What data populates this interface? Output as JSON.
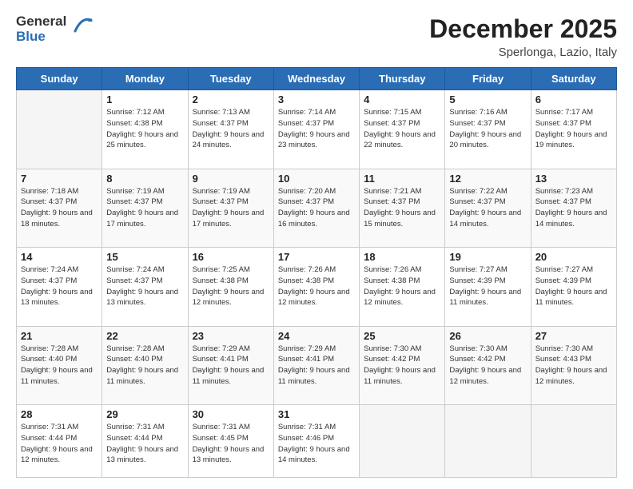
{
  "logo": {
    "general": "General",
    "blue": "Blue"
  },
  "header": {
    "month_year": "December 2025",
    "location": "Sperlonga, Lazio, Italy"
  },
  "weekdays": [
    "Sunday",
    "Monday",
    "Tuesday",
    "Wednesday",
    "Thursday",
    "Friday",
    "Saturday"
  ],
  "weeks": [
    [
      {
        "day": "",
        "sunrise": "",
        "sunset": "",
        "daylight": ""
      },
      {
        "day": "1",
        "sunrise": "Sunrise: 7:12 AM",
        "sunset": "Sunset: 4:38 PM",
        "daylight": "Daylight: 9 hours and 25 minutes."
      },
      {
        "day": "2",
        "sunrise": "Sunrise: 7:13 AM",
        "sunset": "Sunset: 4:37 PM",
        "daylight": "Daylight: 9 hours and 24 minutes."
      },
      {
        "day": "3",
        "sunrise": "Sunrise: 7:14 AM",
        "sunset": "Sunset: 4:37 PM",
        "daylight": "Daylight: 9 hours and 23 minutes."
      },
      {
        "day": "4",
        "sunrise": "Sunrise: 7:15 AM",
        "sunset": "Sunset: 4:37 PM",
        "daylight": "Daylight: 9 hours and 22 minutes."
      },
      {
        "day": "5",
        "sunrise": "Sunrise: 7:16 AM",
        "sunset": "Sunset: 4:37 PM",
        "daylight": "Daylight: 9 hours and 20 minutes."
      },
      {
        "day": "6",
        "sunrise": "Sunrise: 7:17 AM",
        "sunset": "Sunset: 4:37 PM",
        "daylight": "Daylight: 9 hours and 19 minutes."
      }
    ],
    [
      {
        "day": "7",
        "sunrise": "Sunrise: 7:18 AM",
        "sunset": "Sunset: 4:37 PM",
        "daylight": "Daylight: 9 hours and 18 minutes."
      },
      {
        "day": "8",
        "sunrise": "Sunrise: 7:19 AM",
        "sunset": "Sunset: 4:37 PM",
        "daylight": "Daylight: 9 hours and 17 minutes."
      },
      {
        "day": "9",
        "sunrise": "Sunrise: 7:19 AM",
        "sunset": "Sunset: 4:37 PM",
        "daylight": "Daylight: 9 hours and 17 minutes."
      },
      {
        "day": "10",
        "sunrise": "Sunrise: 7:20 AM",
        "sunset": "Sunset: 4:37 PM",
        "daylight": "Daylight: 9 hours and 16 minutes."
      },
      {
        "day": "11",
        "sunrise": "Sunrise: 7:21 AM",
        "sunset": "Sunset: 4:37 PM",
        "daylight": "Daylight: 9 hours and 15 minutes."
      },
      {
        "day": "12",
        "sunrise": "Sunrise: 7:22 AM",
        "sunset": "Sunset: 4:37 PM",
        "daylight": "Daylight: 9 hours and 14 minutes."
      },
      {
        "day": "13",
        "sunrise": "Sunrise: 7:23 AM",
        "sunset": "Sunset: 4:37 PM",
        "daylight": "Daylight: 9 hours and 14 minutes."
      }
    ],
    [
      {
        "day": "14",
        "sunrise": "Sunrise: 7:24 AM",
        "sunset": "Sunset: 4:37 PM",
        "daylight": "Daylight: 9 hours and 13 minutes."
      },
      {
        "day": "15",
        "sunrise": "Sunrise: 7:24 AM",
        "sunset": "Sunset: 4:37 PM",
        "daylight": "Daylight: 9 hours and 13 minutes."
      },
      {
        "day": "16",
        "sunrise": "Sunrise: 7:25 AM",
        "sunset": "Sunset: 4:38 PM",
        "daylight": "Daylight: 9 hours and 12 minutes."
      },
      {
        "day": "17",
        "sunrise": "Sunrise: 7:26 AM",
        "sunset": "Sunset: 4:38 PM",
        "daylight": "Daylight: 9 hours and 12 minutes."
      },
      {
        "day": "18",
        "sunrise": "Sunrise: 7:26 AM",
        "sunset": "Sunset: 4:38 PM",
        "daylight": "Daylight: 9 hours and 12 minutes."
      },
      {
        "day": "19",
        "sunrise": "Sunrise: 7:27 AM",
        "sunset": "Sunset: 4:39 PM",
        "daylight": "Daylight: 9 hours and 11 minutes."
      },
      {
        "day": "20",
        "sunrise": "Sunrise: 7:27 AM",
        "sunset": "Sunset: 4:39 PM",
        "daylight": "Daylight: 9 hours and 11 minutes."
      }
    ],
    [
      {
        "day": "21",
        "sunrise": "Sunrise: 7:28 AM",
        "sunset": "Sunset: 4:40 PM",
        "daylight": "Daylight: 9 hours and 11 minutes."
      },
      {
        "day": "22",
        "sunrise": "Sunrise: 7:28 AM",
        "sunset": "Sunset: 4:40 PM",
        "daylight": "Daylight: 9 hours and 11 minutes."
      },
      {
        "day": "23",
        "sunrise": "Sunrise: 7:29 AM",
        "sunset": "Sunset: 4:41 PM",
        "daylight": "Daylight: 9 hours and 11 minutes."
      },
      {
        "day": "24",
        "sunrise": "Sunrise: 7:29 AM",
        "sunset": "Sunset: 4:41 PM",
        "daylight": "Daylight: 9 hours and 11 minutes."
      },
      {
        "day": "25",
        "sunrise": "Sunrise: 7:30 AM",
        "sunset": "Sunset: 4:42 PM",
        "daylight": "Daylight: 9 hours and 11 minutes."
      },
      {
        "day": "26",
        "sunrise": "Sunrise: 7:30 AM",
        "sunset": "Sunset: 4:42 PM",
        "daylight": "Daylight: 9 hours and 12 minutes."
      },
      {
        "day": "27",
        "sunrise": "Sunrise: 7:30 AM",
        "sunset": "Sunset: 4:43 PM",
        "daylight": "Daylight: 9 hours and 12 minutes."
      }
    ],
    [
      {
        "day": "28",
        "sunrise": "Sunrise: 7:31 AM",
        "sunset": "Sunset: 4:44 PM",
        "daylight": "Daylight: 9 hours and 12 minutes."
      },
      {
        "day": "29",
        "sunrise": "Sunrise: 7:31 AM",
        "sunset": "Sunset: 4:44 PM",
        "daylight": "Daylight: 9 hours and 13 minutes."
      },
      {
        "day": "30",
        "sunrise": "Sunrise: 7:31 AM",
        "sunset": "Sunset: 4:45 PM",
        "daylight": "Daylight: 9 hours and 13 minutes."
      },
      {
        "day": "31",
        "sunrise": "Sunrise: 7:31 AM",
        "sunset": "Sunset: 4:46 PM",
        "daylight": "Daylight: 9 hours and 14 minutes."
      },
      {
        "day": "",
        "sunrise": "",
        "sunset": "",
        "daylight": ""
      },
      {
        "day": "",
        "sunrise": "",
        "sunset": "",
        "daylight": ""
      },
      {
        "day": "",
        "sunrise": "",
        "sunset": "",
        "daylight": ""
      }
    ]
  ]
}
